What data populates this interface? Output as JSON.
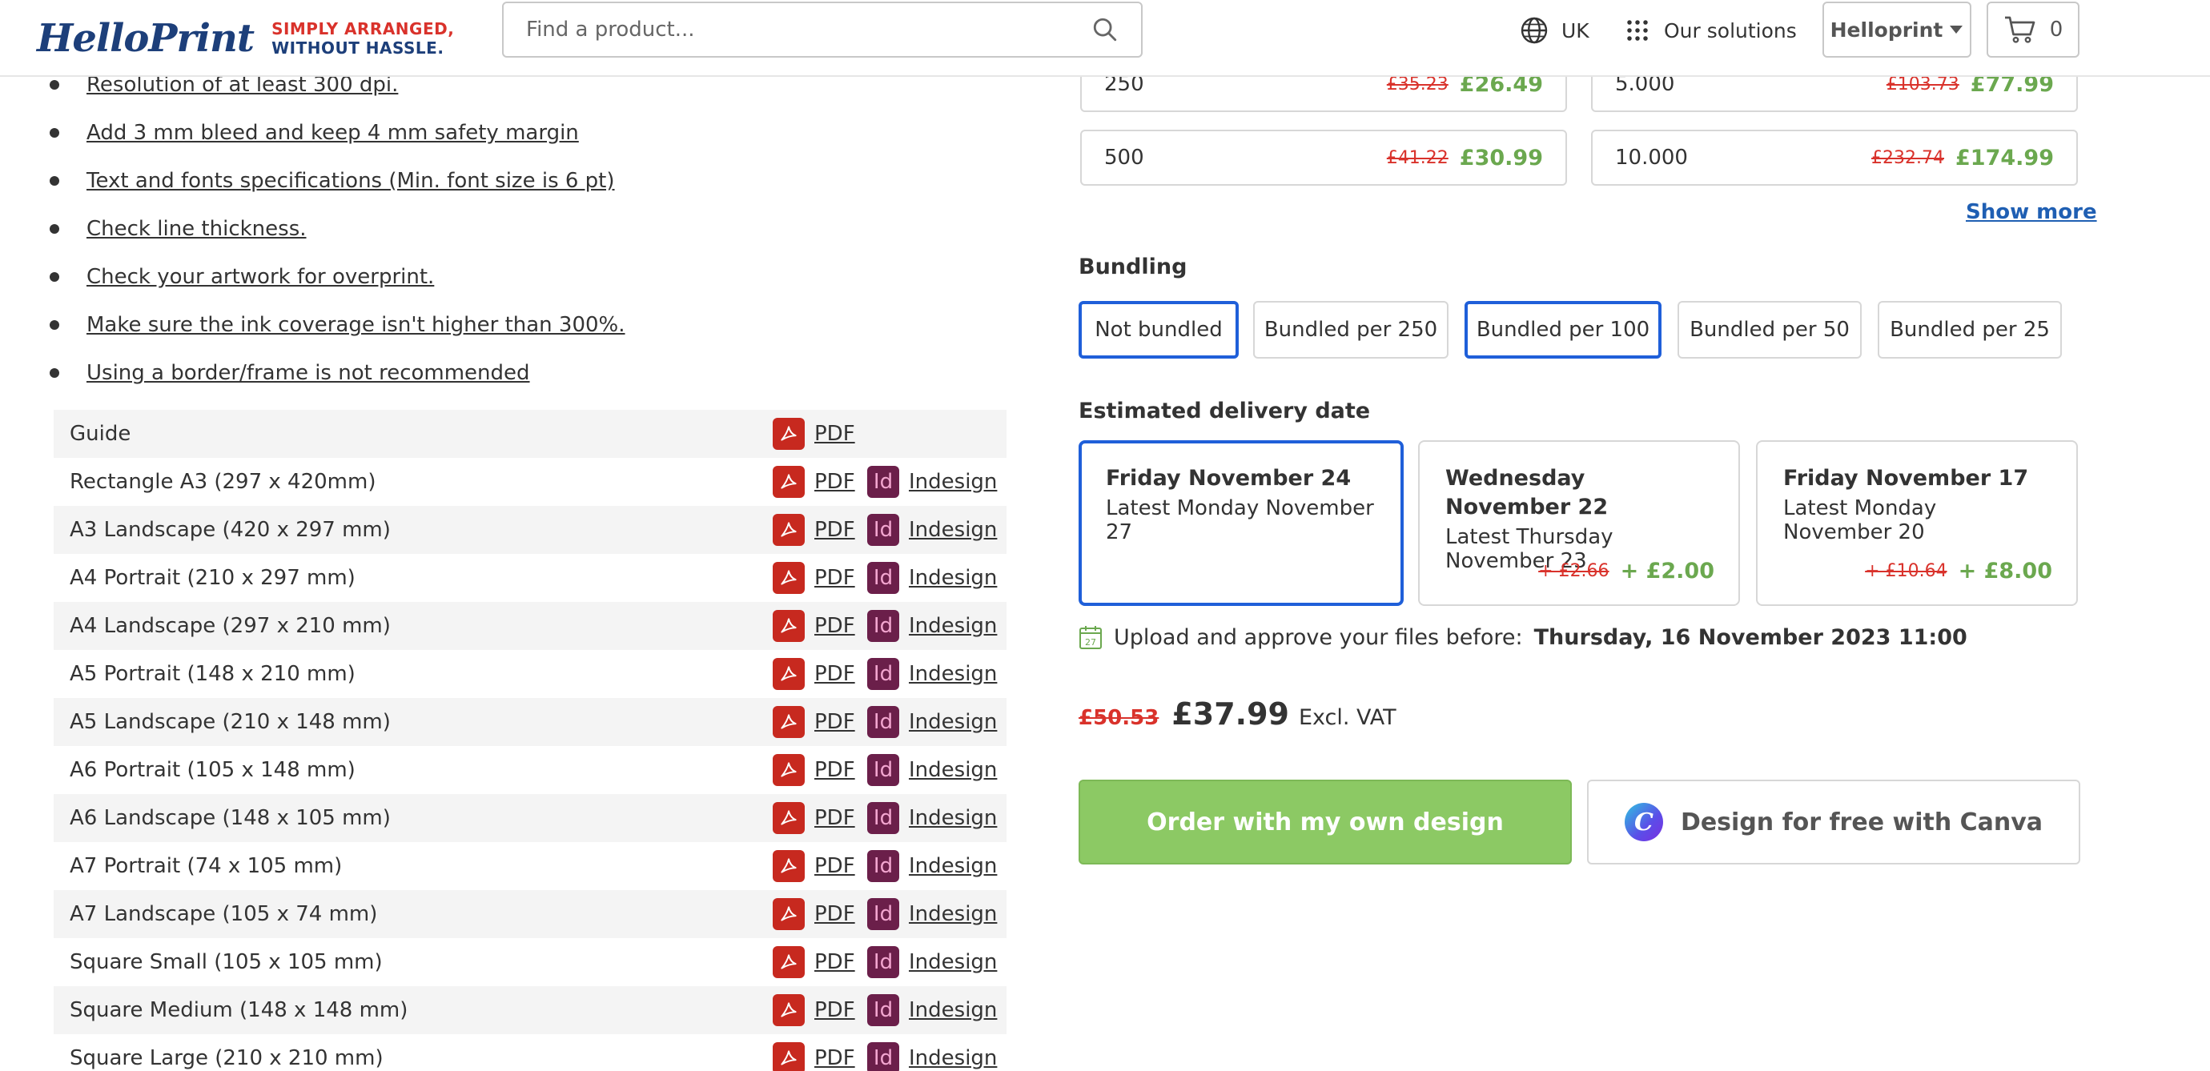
{
  "header": {
    "logo_word": "HelloPrint",
    "tagline_1": "SIMPLY ARRANGED,",
    "tagline_2": "WITHOUT HASSLE.",
    "search_placeholder": "Find a product...",
    "language": "UK",
    "solutions_label": "Our solutions",
    "account_label": "Helloprint",
    "cart_count": "0",
    "colors": {
      "brand_blue": "#1d3f7a",
      "brand_red": "#d9322b"
    }
  },
  "specs": [
    "Resolution of at least 300 dpi.",
    "Add 3 mm bleed and keep 4 mm safety margin",
    "Text and fonts specifications (Min. font size is 6 pt)",
    "Check line thickness.",
    "Check your artwork for overprint.",
    "Make sure the ink coverage isn't higher than 300%.",
    "Using a border/frame is not recommended"
  ],
  "templates": {
    "pdf_label": "PDF",
    "indesign_label": "Indesign",
    "id_icon_text": "Id",
    "rows": [
      {
        "name": "Guide",
        "indesign": false
      },
      {
        "name": "Rectangle A3 (297 x 420mm)",
        "indesign": true
      },
      {
        "name": "A3 Landscape (420 x 297 mm)",
        "indesign": true
      },
      {
        "name": "A4 Portrait (210 x 297 mm)",
        "indesign": true
      },
      {
        "name": "A4 Landscape (297 x 210 mm)",
        "indesign": true
      },
      {
        "name": "A5 Portrait (148 x 210 mm)",
        "indesign": true
      },
      {
        "name": "A5 Landscape (210 x 148 mm)",
        "indesign": true
      },
      {
        "name": "A6 Portrait (105 x 148 mm)",
        "indesign": true
      },
      {
        "name": "A6 Landscape (148 x 105 mm)",
        "indesign": true
      },
      {
        "name": "A7 Portrait (74 x 105 mm)",
        "indesign": true
      },
      {
        "name": "A7 Landscape (105 x 74 mm)",
        "indesign": true
      },
      {
        "name": "Square Small (105 x 105 mm)",
        "indesign": true
      },
      {
        "name": "Square Medium (148 x 148 mm)",
        "indesign": true
      },
      {
        "name": "Square Large (210 x 210 mm)",
        "indesign": true
      }
    ]
  },
  "quantities": [
    {
      "qty": "250",
      "old": "£35.23",
      "new": "£26.49"
    },
    {
      "qty": "5.000",
      "old": "£103.73",
      "new": "£77.99"
    },
    {
      "qty": "500",
      "old": "£41.22",
      "new": "£30.99"
    },
    {
      "qty": "10.000",
      "old": "£232.74",
      "new": "£174.99"
    }
  ],
  "show_more": "Show more",
  "bundling": {
    "title": "Bundling",
    "options": [
      {
        "label": "Not bundled",
        "selected": true
      },
      {
        "label": "Bundled per 250",
        "selected": false
      },
      {
        "label": "Bundled per 100",
        "selected": true
      },
      {
        "label": "Bundled per 50",
        "selected": false
      },
      {
        "label": "Bundled per 25",
        "selected": false
      }
    ]
  },
  "delivery": {
    "title": "Estimated delivery date",
    "options": [
      {
        "date": "Friday November 24",
        "latest": "Latest Monday November 27",
        "old": "",
        "extra": "",
        "selected": true
      },
      {
        "date": "Wednesday November 22",
        "latest": "Latest Thursday November 23",
        "old": "+ £2.66",
        "extra": "+ £2.00",
        "selected": false
      },
      {
        "date": "Friday November 17",
        "latest": "Latest Monday November 20",
        "old": "+ £10.64",
        "extra": "+ £8.00",
        "selected": false
      }
    ],
    "calendar_day": "27",
    "upload_text": "Upload and approve your files before:",
    "upload_deadline": "Thursday, 16 November 2023 11:00"
  },
  "total": {
    "old": "£50.53",
    "price": "£37.99",
    "vat": "Excl. VAT"
  },
  "buttons": {
    "order": "Order with my own design",
    "canva": "Design for free with Canva",
    "canva_letter": "C"
  },
  "colors": {
    "selected_border": "#1f5fd9",
    "price_green": "#6ba84f",
    "order_green": "#8cc964",
    "link_blue": "#1f5fb3"
  }
}
